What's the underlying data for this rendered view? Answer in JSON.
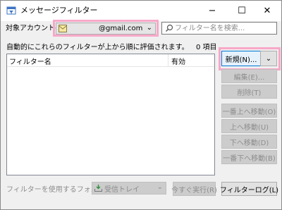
{
  "window": {
    "title": "メッセージフィルター",
    "minimize": "−",
    "maximize": "☐",
    "close": "✕"
  },
  "account": {
    "label": "対象アカウント(F):",
    "value": "@gmail.com",
    "chevron": "⌄"
  },
  "search": {
    "placeholder": "フィルター名を検索..."
  },
  "list": {
    "description": "自動的にこれらのフィルターが上から順に評価されます。",
    "count": "0 項目",
    "columns": [
      "フィルター名",
      "有効"
    ]
  },
  "buttons": {
    "new": "新規(N)...",
    "new_dropdown": "⌄",
    "edit": "編集(E)...",
    "delete": "削除(T)",
    "move_top": "一番上へ移動(O)",
    "move_up": "上へ移動(U)",
    "move_down": "下へ移動(D)",
    "move_bottom": "一番下へ移動(B)",
    "run_now": "今すぐ実行(R)",
    "filter_log": "フィルターログ(L)"
  },
  "folder": {
    "label": "フィルターを使用するフォルダー(C):",
    "value": "受信トレイ",
    "chevron": "⌄"
  },
  "icons": {
    "app": "filter-app-icon",
    "account": "account-icon",
    "search": "search-icon",
    "folder": "inbox-icon"
  }
}
